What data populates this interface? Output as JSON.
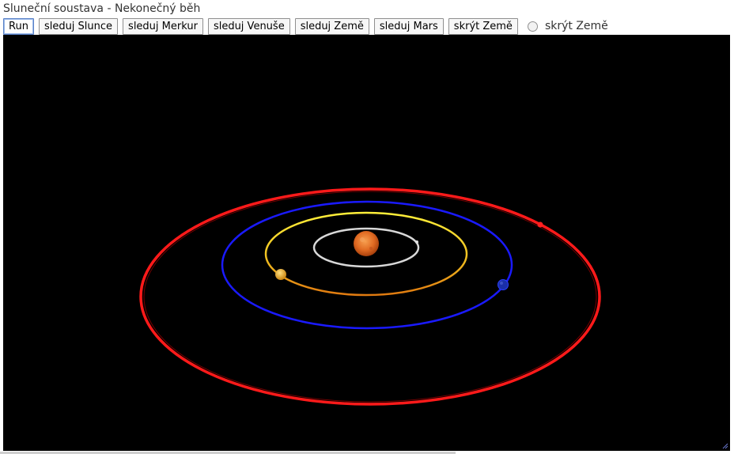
{
  "title": "Sluneční soustava - Nekonečný běh",
  "toolbar": {
    "buttons": [
      {
        "label": "Run"
      },
      {
        "label": "sleduj Slunce"
      },
      {
        "label": "sleduj Merkur"
      },
      {
        "label": "sleduj Venuše"
      },
      {
        "label": "sleduj Země"
      },
      {
        "label": "sleduj Mars"
      },
      {
        "label": "skrýt Země"
      }
    ],
    "radio_label": "skrýt Země"
  },
  "colors": {
    "sun": "#e8752a",
    "mercury_orbit": "#d8d8d8",
    "venus_orbit": "#f0c020",
    "earth_orbit": "#1a1aff",
    "mars_orbit": "#ff1a1a",
    "background": "#000000"
  }
}
